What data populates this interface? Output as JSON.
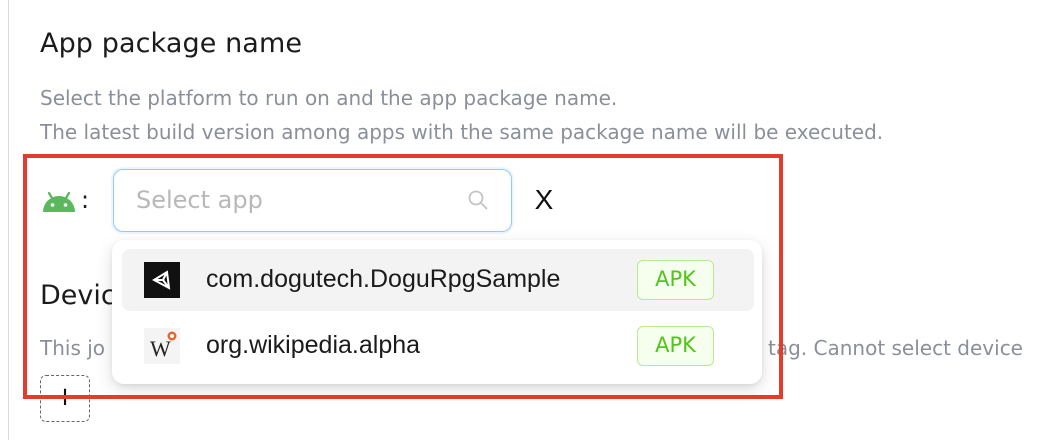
{
  "section": {
    "title": "App package name",
    "description_line1": "Select the platform to run on and the app package name.",
    "description_line2": "The latest build version among apps with the same package name will be executed."
  },
  "platform": {
    "icon": "android-icon",
    "separator": ":",
    "color": "#5cb85c"
  },
  "app_select": {
    "placeholder": "Select app",
    "clear_label": "X"
  },
  "dropdown": {
    "options": [
      {
        "label": "com.dogutech.DoguRpgSample",
        "icon": "unity-icon",
        "tag": "APK",
        "active": true
      },
      {
        "label": "org.wikipedia.alpha",
        "icon": "wikipedia-icon",
        "tag": "APK",
        "active": false
      }
    ]
  },
  "background_section": {
    "title_visible": "Devic",
    "description_left": "This jo",
    "description_right": "tag. Cannot select device",
    "add_label": "+"
  },
  "colors": {
    "tag_text": "#52c41a",
    "tag_border": "#b7eb8f",
    "highlight": "#e53b2a",
    "input_border": "#91caff"
  }
}
